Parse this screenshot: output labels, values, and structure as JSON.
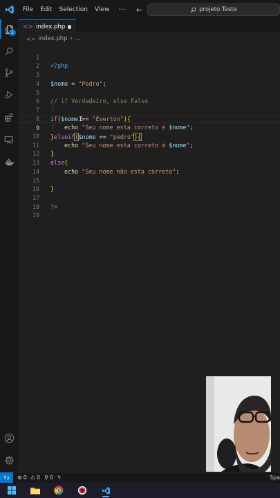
{
  "titlebar": {
    "menu": [
      "File",
      "Edit",
      "Selection",
      "View"
    ],
    "more": "···",
    "search_text": "projeto Teste"
  },
  "tabs": [
    {
      "label": "index.php",
      "modified": true
    }
  ],
  "breadcrumb": {
    "file": "index.php",
    "sep": "›",
    "more": "..."
  },
  "editor": {
    "current_line": 9,
    "lines": [
      {
        "n": "1"
      },
      {
        "n": "2"
      },
      {
        "n": "3"
      },
      {
        "n": "4"
      },
      {
        "n": "5"
      },
      {
        "n": "6"
      },
      {
        "n": "7"
      },
      {
        "n": "8"
      },
      {
        "n": "9"
      },
      {
        "n": "10"
      },
      {
        "n": "11"
      },
      {
        "n": "12"
      },
      {
        "n": "13"
      },
      {
        "n": "14"
      },
      {
        "n": "15"
      },
      {
        "n": "16"
      },
      {
        "n": "17"
      },
      {
        "n": "18"
      },
      {
        "n": "19"
      }
    ],
    "code": {
      "l1": "<?php",
      "l3_var": "$nome",
      "l3_op": " = ",
      "l3_str": "\"Pedro\"",
      "l3_end": ";",
      "l5": "// if Verdadeiro, else Falso",
      "l7_kw": "if",
      "l7_p1": "(",
      "l7_var": "$nome",
      "l7_op": " == ",
      "l7_str": "\"Everton\"",
      "l7_p2": "){",
      "l8_fn": "echo",
      "l8_str": "\"Seu nome esta correto é ",
      "l8_var": "$nome",
      "l8_str2": "\"",
      "l8_end": ";",
      "l9_b": "}",
      "l9_kw": "elseif",
      "l9_p1": "(",
      "l9_var": "$nome",
      "l9_op": " == ",
      "l9_str": "\"pedro\"",
      "l9_p2": "){",
      "l10_fn": "echo",
      "l10_str": "\"Seu nome esta correto é ",
      "l10_var": "$nome",
      "l10_str2": "\"",
      "l10_end": ";",
      "l11": "}",
      "l12_kw": "else",
      "l12_b": "{",
      "l13_fn": "echo",
      "l13_str": "\"Seu nome não esta correto\"",
      "l13_end": ";",
      "l15": "}",
      "l17": "?>"
    }
  },
  "statusbar": {
    "errors": "0",
    "warnings": "0",
    "ports": "0",
    "right_text": "Spa"
  },
  "colors": {
    "accent": "#0078d4",
    "editor_bg": "#1f1f1f",
    "chrome_bg": "#181818"
  },
  "icons": [
    "vscode-logo-icon",
    "explorer-icon",
    "search-icon",
    "source-control-icon",
    "run-debug-icon",
    "extensions-icon",
    "remote-explorer-icon",
    "docker-icon",
    "account-icon",
    "settings-gear-icon"
  ]
}
